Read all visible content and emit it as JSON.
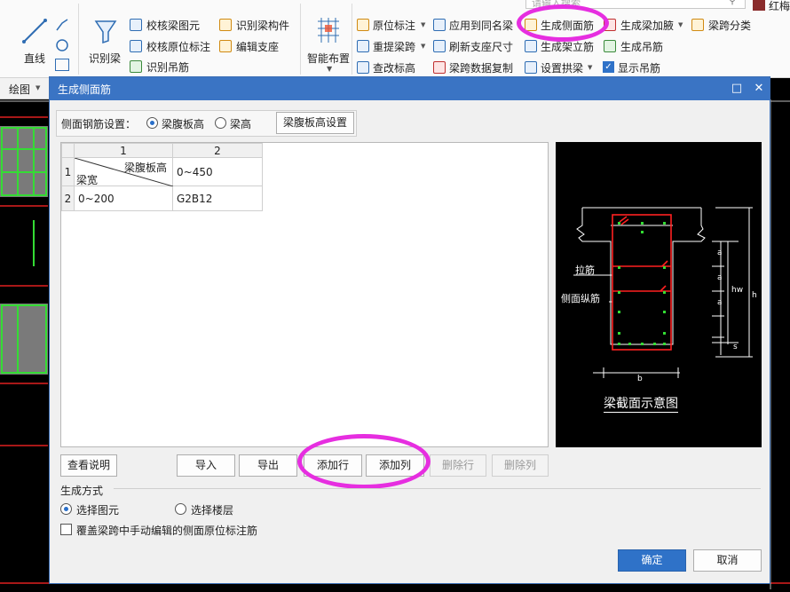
{
  "ribbon": {
    "search_placeholder": "请输入搜索",
    "user_name": "红梅",
    "left_tool": "直线",
    "recognize_group": {
      "big_button": "识别梁",
      "items": [
        "校核梁图元",
        "识别梁构件",
        "校核原位标注",
        "编辑支座",
        "识别吊筋"
      ]
    },
    "smart_layout": "智能布置",
    "edit_group": {
      "items": [
        "原位标注",
        "应用到同名梁",
        "生成侧面筋",
        "生成梁加腋",
        "梁跨分类",
        "重提梁跨",
        "刷新支座尺寸",
        "生成架立筋",
        "生成吊筋",
        "查改标高",
        "梁跨数据复制",
        "设置拱梁",
        "显示吊筋"
      ]
    },
    "draw_group": "绘图"
  },
  "dialog": {
    "title": "生成侧面筋",
    "setting_label": "侧面钢筋设置：",
    "option_web_height": "梁腹板高",
    "option_beam_height": "梁高",
    "web_height_settings_button": "梁腹板高设置",
    "table": {
      "col_headers": [
        "1",
        "2"
      ],
      "row_headers": [
        "1",
        "2"
      ],
      "header_cell_top": "梁腹板高",
      "header_cell_bottom": "梁宽",
      "row1_col2": "0~450",
      "row2_col1": "0~200",
      "row2_col2": "G2B12"
    },
    "diagram": {
      "caption": "梁截面示意图",
      "label_tie": "拉筋",
      "label_side": "侧面纵筋",
      "dim_a": "a",
      "dim_hw": "hw",
      "dim_h": "h",
      "dim_s": "s",
      "dim_b": "b"
    },
    "buttons": {
      "view_help": "查看说明",
      "import": "导入",
      "export": "导出",
      "add_row": "添加行",
      "add_col": "添加列",
      "delete_row": "删除行",
      "delete_col": "删除列"
    },
    "generate_mode_label": "生成方式",
    "mode_select_element": "选择图元",
    "mode_select_floor": "选择楼层",
    "override_checkbox": "覆盖梁跨中手动编辑的侧面原位标注筋",
    "ok": "确定",
    "cancel": "取消"
  },
  "colors": {
    "title_bar": "#3a74c4",
    "highlight_circle": "#e62ee0",
    "rebar_red": "#ff2020",
    "rebar_green": "#33dd33"
  }
}
